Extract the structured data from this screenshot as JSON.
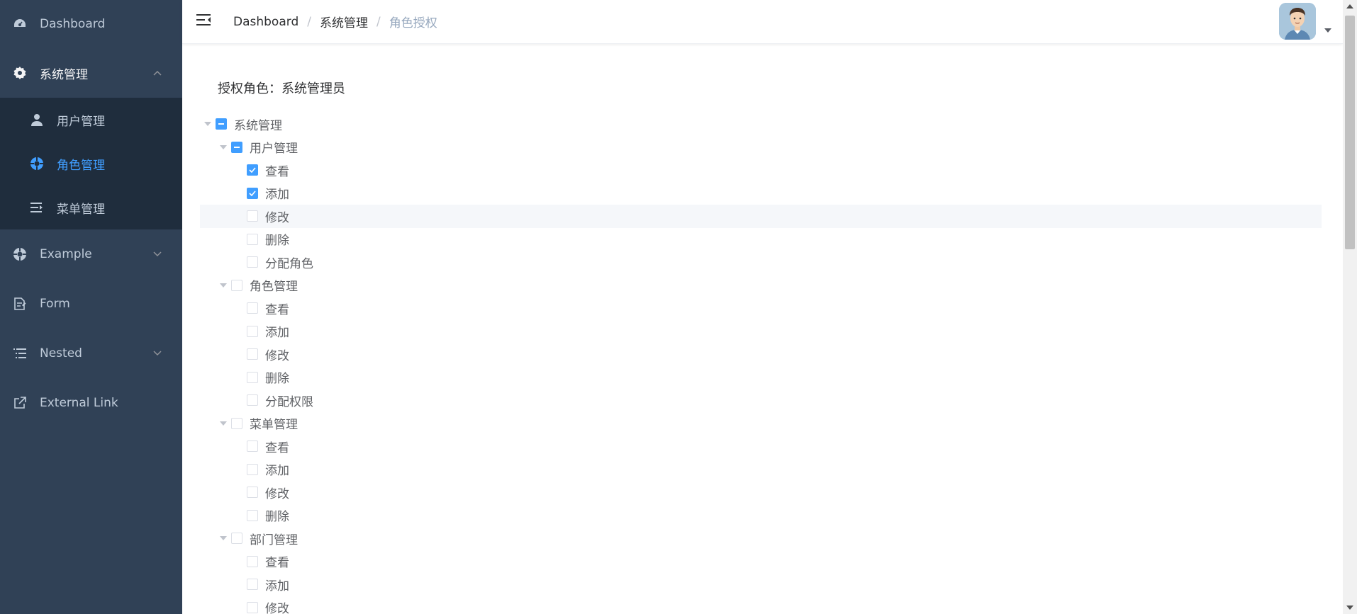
{
  "sidebar": {
    "dashboard": "Dashboard",
    "system": "系统管理",
    "sub": [
      "用户管理",
      "角色管理",
      "菜单管理"
    ],
    "example": "Example",
    "form": "Form",
    "nested": "Nested",
    "external": "External Link"
  },
  "breadcrumb": [
    "Dashboard",
    "系统管理",
    "角色授权"
  ],
  "role_title": "授权角色：系统管理员",
  "tree": {
    "root": "系统管理",
    "user": {
      "label": "用户管理",
      "perms": [
        "查看",
        "添加",
        "修改",
        "删除",
        "分配角色"
      ]
    },
    "role": {
      "label": "角色管理",
      "perms": [
        "查看",
        "添加",
        "修改",
        "删除",
        "分配权限"
      ]
    },
    "menu": {
      "label": "菜单管理",
      "perms": [
        "查看",
        "添加",
        "修改",
        "删除"
      ]
    },
    "dept": {
      "label": "部门管理",
      "perms": [
        "查看",
        "添加",
        "修改"
      ]
    }
  },
  "colors": {
    "sidebar_bg": "#304156",
    "submenu_bg": "#1f2d3d",
    "active": "#409eff"
  }
}
